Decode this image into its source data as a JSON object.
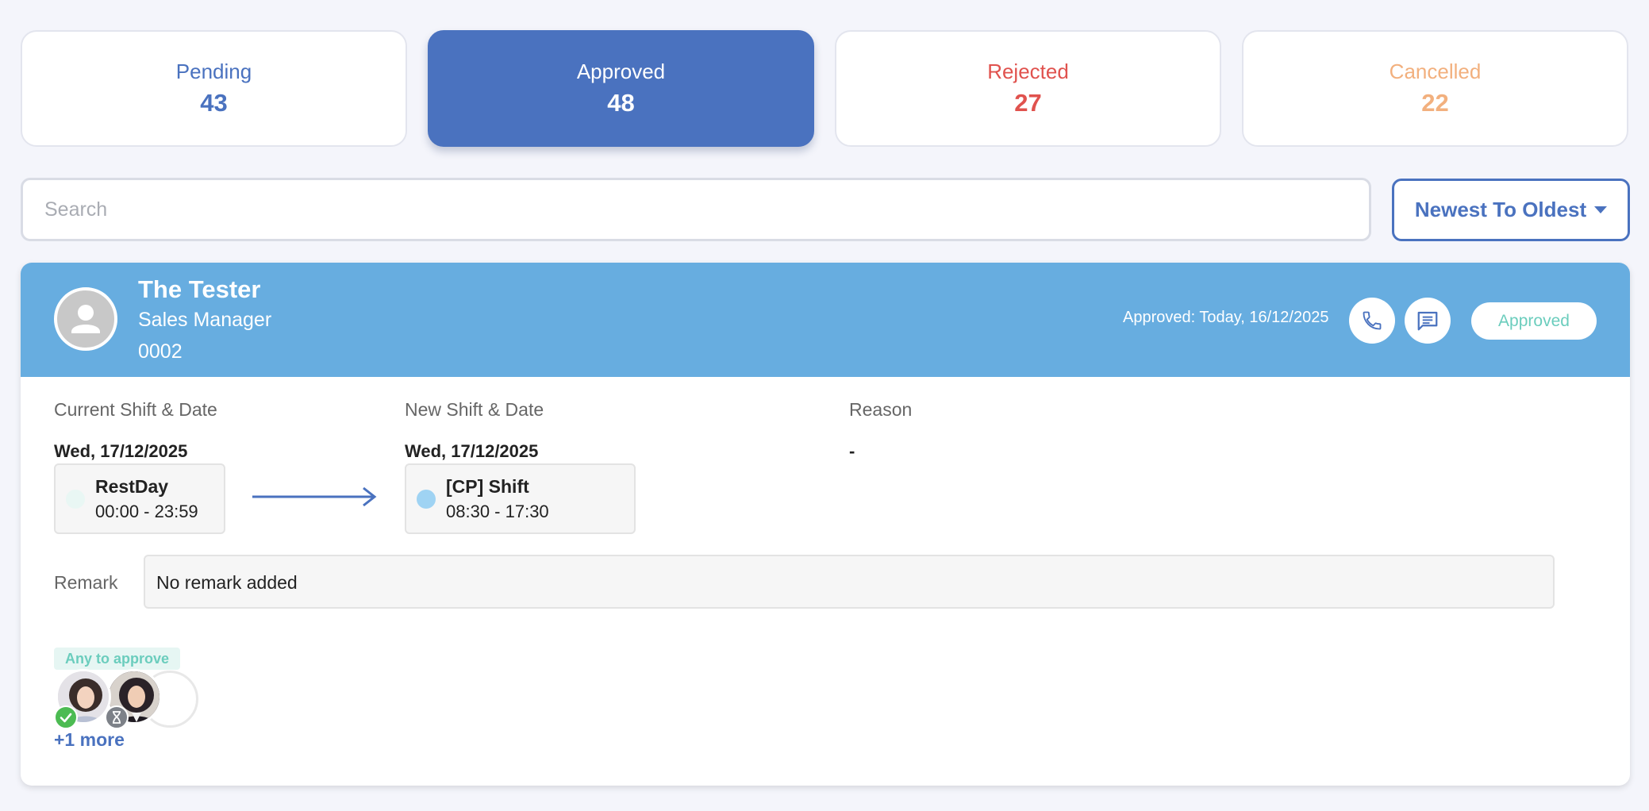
{
  "stats": [
    {
      "label": "Pending",
      "count": "43"
    },
    {
      "label": "Approved",
      "count": "48"
    },
    {
      "label": "Rejected",
      "count": "27"
    },
    {
      "label": "Cancelled",
      "count": "22"
    }
  ],
  "search": {
    "placeholder": "Search",
    "value": ""
  },
  "sort": {
    "label": "Newest To Oldest"
  },
  "request": {
    "employee": {
      "name": "The Tester",
      "title": "Sales Manager",
      "id": "0002"
    },
    "approved_text": "Approved: Today, 16/12/2025",
    "status": "Approved",
    "current": {
      "title": "Current Shift & Date",
      "date": "Wed, 17/12/2025",
      "shift_name": "RestDay",
      "shift_time": "00:00 - 23:59",
      "dot_color": "#e9f7f4"
    },
    "new": {
      "title": "New Shift & Date",
      "date": "Wed, 17/12/2025",
      "shift_name": "[CP] Shift",
      "shift_time": "08:30 - 17:30",
      "dot_color": "#9fd3f3"
    },
    "reason": {
      "title": "Reason",
      "value": "-"
    },
    "remark": {
      "label": "Remark",
      "value": "No remark added"
    },
    "approvers": {
      "tag": "Any to approve",
      "more": "+1 more"
    }
  },
  "colors": {
    "primary": "#4a72bf",
    "header": "#67ade0",
    "rejected": "#e0524e",
    "cancelled": "#f2b07e",
    "approved_status": "#6bcdbd"
  },
  "icons": [
    "user-icon",
    "phone-icon",
    "chat-icon",
    "check-icon",
    "hourglass-icon",
    "caret-down-icon",
    "arrow-right-icon"
  ]
}
